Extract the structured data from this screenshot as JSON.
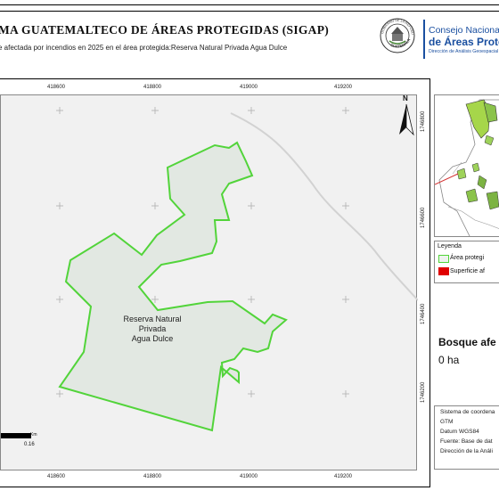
{
  "header": {
    "title": "MA GUATEMALTECO DE ÁREAS PROTEGIDAS  (SIGAP)",
    "subtitle": "e afectada por incendios en 2025 en el área protegida:Reserva Natural Privada Agua Dulce",
    "logo_text_top": "GOBIERNO DE LA REPÚBLICA",
    "logo_text_bottom": "GUATEMALA",
    "conap_line1": "Consejo Nacional",
    "conap_line2": "de Áreas Protegi",
    "conap_line3": "Dirección de Análisis Geoespacial"
  },
  "map": {
    "x_ticks": [
      "418600",
      "418800",
      "419000",
      "419200"
    ],
    "x_ticks_bottom": [
      "418600",
      "418800",
      "419000",
      "419200"
    ],
    "y_ticks": [
      "1746800",
      "1746600",
      "1746400",
      "1746200"
    ],
    "area_label_lines": [
      "Reserva Natural",
      "Privada",
      "Agua Dulce"
    ],
    "north_label": "N",
    "scale_unit": "Km",
    "scale_value": "0.16",
    "colors": {
      "area_stroke": "#52d43a",
      "area_fill": "#e2e8e2",
      "map_bg": "#f1f1f1",
      "affected": "#e00000"
    }
  },
  "legend": {
    "title": "Leyenda",
    "items": [
      {
        "label": "Área protegi",
        "swatch": "outline-green"
      },
      {
        "label": "Superficie af",
        "swatch": "fill-red"
      }
    ]
  },
  "stats": {
    "title": "Bosque afe",
    "value": "0 ha"
  },
  "metadata": {
    "lines": [
      "Sistema de coordena",
      "GTM",
      "Datum WGS84",
      "Fuente: Base de dat",
      "Dirección de la Análi"
    ]
  }
}
